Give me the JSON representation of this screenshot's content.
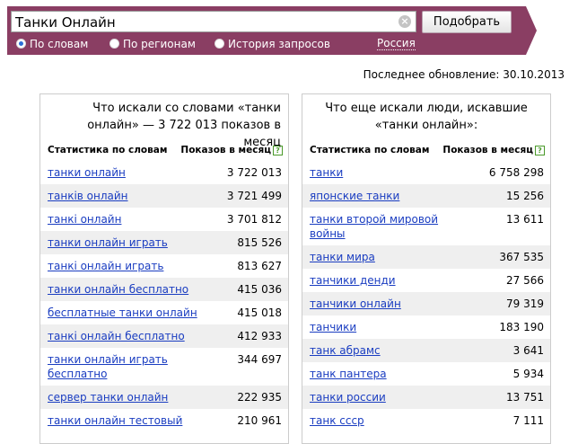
{
  "search": {
    "query": "Танки Онлайн",
    "button_label": "Подобрать",
    "clear_glyph": "×",
    "modes": [
      {
        "label": "По словам",
        "selected": true
      },
      {
        "label": "По регионам",
        "selected": false
      },
      {
        "label": "История запросов",
        "selected": false
      }
    ],
    "region": "Россия"
  },
  "updated": "Последнее обновление: 30.10.2013",
  "left": {
    "title": "Что искали со словами «танки онлайн» — 3 722 013 показов в месяц",
    "col1": "Статистика по словам",
    "col2": "Показов в месяц",
    "help": "?",
    "rows": [
      {
        "phrase": "танки онлайн",
        "count": "3 722 013"
      },
      {
        "phrase": "танків онлайн",
        "count": "3 721 499"
      },
      {
        "phrase": "танкі онлайн",
        "count": "3 701 812"
      },
      {
        "phrase": "танки онлайн играть",
        "count": "815 526"
      },
      {
        "phrase": "танкі онлайн играть",
        "count": "813 627"
      },
      {
        "phrase": "танки онлайн бесплатно",
        "count": "415 036"
      },
      {
        "phrase": "бесплатные танки онлайн",
        "count": "415 018"
      },
      {
        "phrase": "танкі онлайн бесплатно",
        "count": "412 933"
      },
      {
        "phrase": "танки онлайн играть бесплатно",
        "count": "344 697"
      },
      {
        "phrase": "сервер танки онлайн",
        "count": "222 935"
      },
      {
        "phrase": "танки онлайн тестовый",
        "count": "210 961"
      }
    ]
  },
  "right": {
    "title": "Что еще искали люди, искавшие «танки онлайн»:",
    "col1": "Статистика по словам",
    "col2": "Показов в месяц",
    "help": "?",
    "rows": [
      {
        "phrase": "танки",
        "count": "6 758 298"
      },
      {
        "phrase": "японские танки",
        "count": "15 256"
      },
      {
        "phrase": "танки второй мировой войны",
        "count": "13 611"
      },
      {
        "phrase": "танки мира",
        "count": "367 535"
      },
      {
        "phrase": "танчики денди",
        "count": "27 566"
      },
      {
        "phrase": "танчики онлайн",
        "count": "79 319"
      },
      {
        "phrase": "танчики",
        "count": "183 190"
      },
      {
        "phrase": "танк абрамс",
        "count": "3 641"
      },
      {
        "phrase": "танк пантера",
        "count": "5 934"
      },
      {
        "phrase": "танки россии",
        "count": "13 751"
      },
      {
        "phrase": "танк ссср",
        "count": "7 111"
      }
    ]
  }
}
